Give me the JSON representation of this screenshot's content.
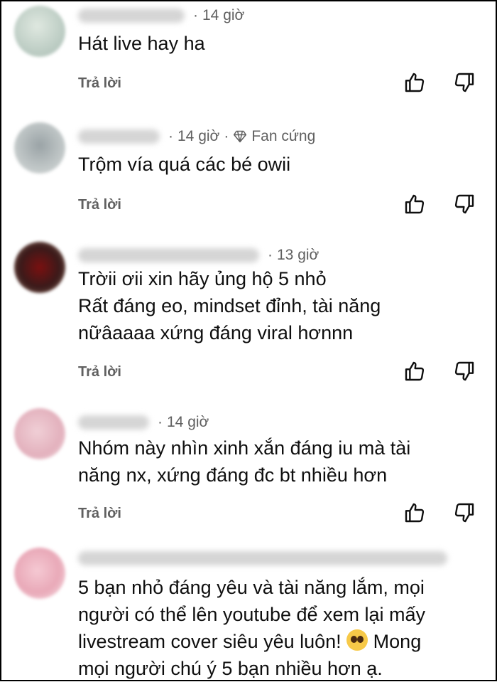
{
  "reply_label": "Trả lời",
  "comments": [
    {
      "time": "14 giờ",
      "text": "Hát live hay ha"
    },
    {
      "time": "14 giờ",
      "badge": "Fan cứng",
      "text": "Trộm vía quá các bé owii"
    },
    {
      "time": "13 giờ",
      "text": "Trờii ơii xin hãy ủng hộ 5 nhỏ\nRất đáng eo, mindset đỉnh, tài năng\nnữâaaaa xứng đáng viral hơnnn"
    },
    {
      "time": "14 giờ",
      "text": "Nhóm này nhìn xinh xắn đáng iu mà tài\nnăng nx, xứng đáng đc bt nhiều hơn"
    },
    {
      "text_a": "5 bạn nhỏ đáng yêu và tài năng lắm, mọi\nngười có thể lên youtube để xem lại mấy\nlivestream cover siêu yêu luôn! ",
      "emoji": "pleading-face",
      "text_b": " Mong\nmọi người chú ý 5 bạn nhiều hơn ạ."
    }
  ],
  "icons": {
    "like": "thumbs-up-icon",
    "dislike": "thumbs-down-icon",
    "badge": "diamond-icon"
  }
}
